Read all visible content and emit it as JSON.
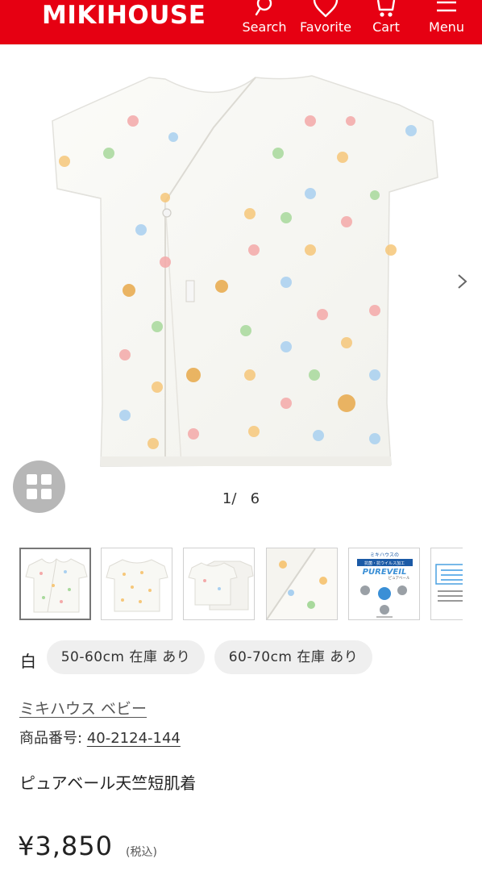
{
  "header": {
    "logo": "MIKIHOUSE",
    "nav": {
      "search": "Search",
      "favorite": "Favorite",
      "cart": "Cart",
      "menu": "Menu"
    },
    "icons": [
      "search-icon",
      "heart-icon",
      "cart-icon",
      "menu-icon"
    ],
    "brand_color": "#e60012"
  },
  "gallery": {
    "current": "1/",
    "total": "6",
    "thumbnails": [
      {
        "name": "front",
        "active": true
      },
      {
        "name": "back",
        "active": false
      },
      {
        "name": "layered",
        "active": false
      },
      {
        "name": "detail",
        "active": false
      },
      {
        "name": "pureveil-info",
        "active": false,
        "text": {
          "line1": "ミキハウスの",
          "line2": "抗菌・抗ウイルス加工",
          "brand": "PUREVEIL",
          "sub": "ピュアベール"
        }
      },
      {
        "name": "label-info",
        "active": false
      }
    ]
  },
  "variants": {
    "color": "白",
    "sizes": [
      {
        "label": "50-60cm 在庫 あり"
      },
      {
        "label": "60-70cm 在庫 あり"
      }
    ]
  },
  "product": {
    "brand": "ミキハウス ベビー",
    "sku_label": "商品番号:",
    "sku": "40-2124-144",
    "name": "ピュアベール天竺短肌着",
    "price": "¥3,850",
    "tax_note": "(税込)"
  }
}
